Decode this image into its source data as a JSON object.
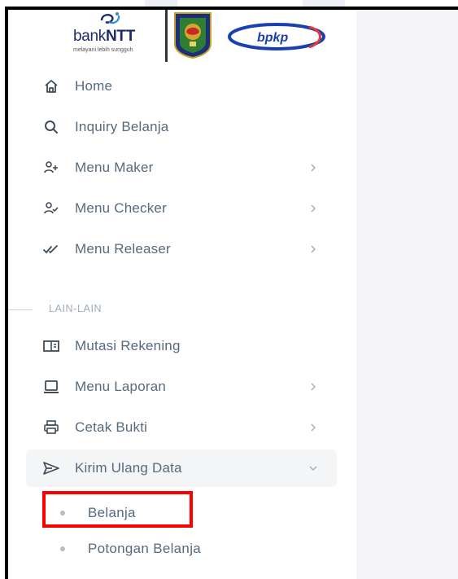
{
  "brand": {
    "bank_name_light": "bank",
    "bank_name_bold": "NTT",
    "bank_tagline": "melayani lebih sungguh",
    "bpkp": "bpkp"
  },
  "menu": [
    {
      "label": "Home",
      "icon": "home-icon",
      "has_chevron": false
    },
    {
      "label": "Inquiry Belanja",
      "icon": "search-icon",
      "has_chevron": false
    },
    {
      "label": "Menu Maker",
      "icon": "user-plus-icon",
      "has_chevron": true
    },
    {
      "label": "Menu Checker",
      "icon": "user-check-icon",
      "has_chevron": true
    },
    {
      "label": "Menu Releaser",
      "icon": "double-check-icon",
      "has_chevron": true
    }
  ],
  "section": {
    "label": "LAIN-LAIN"
  },
  "menu2": [
    {
      "label": "Mutasi Rekening",
      "icon": "book-open-icon",
      "has_chevron": false
    },
    {
      "label": "Menu Laporan",
      "icon": "laptop-icon",
      "has_chevron": true
    },
    {
      "label": "Cetak Bukti",
      "icon": "printer-icon",
      "has_chevron": true
    },
    {
      "label": "Kirim Ulang Data",
      "icon": "send-icon",
      "has_chevron": true,
      "expanded": true
    }
  ],
  "submenu": [
    {
      "label": "Belanja",
      "highlighted": true
    },
    {
      "label": "Potongan Belanja",
      "highlighted": false
    }
  ],
  "colors": {
    "text": "#566a7f",
    "muted": "#a1acb8",
    "active_bg": "#f4f5f7",
    "highlight": "#ff0000",
    "bank_blue": "#1b2a6b",
    "bpkp_blue": "#1a3fb0"
  }
}
